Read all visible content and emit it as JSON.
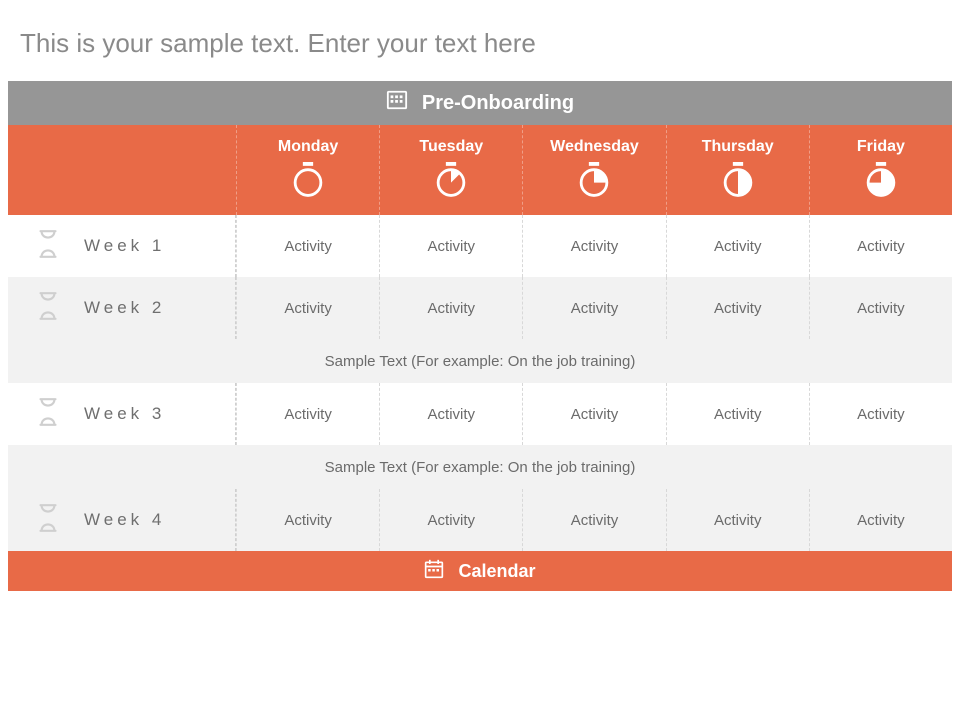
{
  "title": "This is your sample text. Enter your text here",
  "section_header": "Pre-Onboarding",
  "days": [
    "Monday",
    "Tuesday",
    "Wednesday",
    "Thursday",
    "Friday"
  ],
  "weeks": [
    {
      "label": "Week 1",
      "cells": [
        "Activity",
        "Activity",
        "Activity",
        "Activity",
        "Activity"
      ]
    },
    {
      "label": "Week 2",
      "cells": [
        "Activity",
        "Activity",
        "Activity",
        "Activity",
        "Activity"
      ]
    },
    {
      "label": "Week 3",
      "cells": [
        "Activity",
        "Activity",
        "Activity",
        "Activity",
        "Activity"
      ]
    },
    {
      "label": "Week 4",
      "cells": [
        "Activity",
        "Activity",
        "Activity",
        "Activity",
        "Activity"
      ]
    }
  ],
  "sample_text": "Sample Text (For example: On the job training)",
  "footer": "Calendar",
  "colors": {
    "accent": "#e86a47",
    "gray_header": "#969696",
    "text_muted": "#6b6b6b"
  }
}
